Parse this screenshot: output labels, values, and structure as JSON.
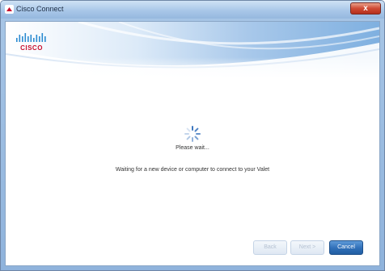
{
  "window": {
    "title": "Cisco Connect",
    "close_label": "x"
  },
  "brand": {
    "logo_icon": "cisco-logo",
    "logo_text": "CISCO",
    "accent_color": "#c8102e"
  },
  "status": {
    "spinner_icon": "loading-spinner-icon",
    "please_wait": "Please wait...",
    "message": "Waiting for a new device or computer to connect to your Valet"
  },
  "buttons": {
    "back": "Back",
    "next": "Next >",
    "cancel": "Cancel"
  }
}
